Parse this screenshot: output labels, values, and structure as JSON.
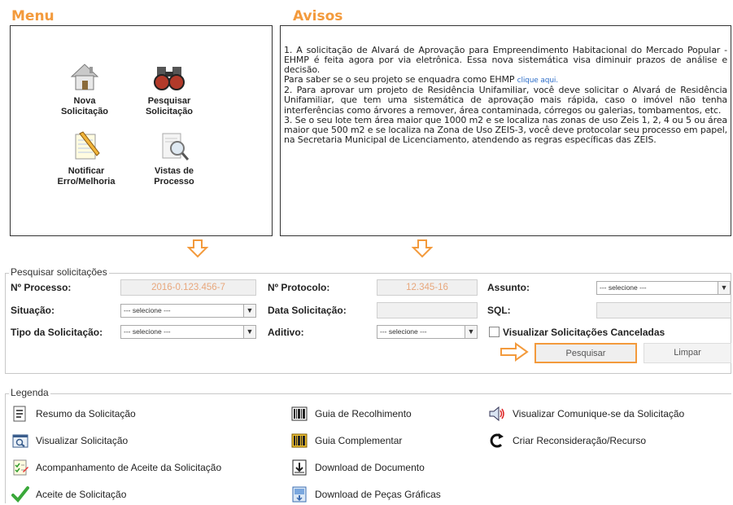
{
  "menu": {
    "title": "Menu",
    "items": [
      {
        "label1": "Nova",
        "label2": "Solicitação",
        "icon": "house-icon"
      },
      {
        "label1": "Pesquisar",
        "label2": "Solicitação",
        "icon": "binoculars-icon"
      },
      {
        "label1": "Notificar",
        "label2": "Erro/Melhoria",
        "icon": "notepad-pencil-icon"
      },
      {
        "label1": "Vistas de",
        "label2": "Processo",
        "icon": "magnifier-document-icon"
      }
    ]
  },
  "avisos": {
    "title": "Avisos",
    "p1": "1. A solicitação de Alvará de Aprovação para Empreendimento Habitacional do Mercado Popular - EHMP é feita agora por via eletrônica. Essa nova sistemática visa diminuir prazos de análise e decisão.",
    "p2a": "Para saber se o seu projeto se enquadra como EHMP",
    "p2link": "clique aqui.",
    "p3": "2. Para aprovar um projeto de Residência Unifamiliar, você deve solicitar o Alvará de Residência Unifamiliar, que tem uma sistemática de aprovação mais rápida, caso o imóvel não tenha interferências como árvores a remover, área contaminada, córregos ou galerias, tombamentos, etc.",
    "p4": "3. Se o seu lote tem área maior que 1000 m2 e se localiza nas zonas de uso Zeis 1, 2, 4 ou 5 ou área maior que 500 m2 e se localiza na Zona de Uso ZEIS-3, você deve protocolar seu processo em papel, na Secretaria Municipal de Licenciamento, atendendo as regras específicas das ZEIS."
  },
  "search": {
    "legend": "Pesquisar solicitações",
    "processo_label": "Nº Processo:",
    "processo_value": "2016-0.123.456-7",
    "protocolo_label": "Nº Protocolo:",
    "protocolo_value": "12.345-16",
    "assunto_label": "Assunto:",
    "assunto_value": "--- selecione ---",
    "situacao_label": "Situação:",
    "situacao_value": "--- selecione ---",
    "data_label": "Data Solicitação:",
    "data_value": "",
    "sql_label": "SQL:",
    "sql_value": "",
    "tipo_label": "Tipo da Solicitação:",
    "tipo_value": "--- selecione ---",
    "aditivo_label": "Aditivo:",
    "aditivo_value": "--- selecione ---",
    "canceladas_label": "Visualizar Solicitações Canceladas",
    "pesquisar_label": "Pesquisar",
    "limpar_label": "Limpar"
  },
  "legend": {
    "title": "Legenda",
    "items": [
      {
        "label": "Resumo da Solicitação",
        "icon": "document-summary-icon"
      },
      {
        "label": "Guia de Recolhimento",
        "icon": "barcode-icon"
      },
      {
        "label": "Visualizar Comunique-se da Solicitação",
        "icon": "speaker-icon"
      },
      {
        "label": "Visualizar Solicitação",
        "icon": "view-window-icon"
      },
      {
        "label": "Guia Complementar",
        "icon": "barcode-yellow-icon"
      },
      {
        "label": "Criar Reconsideração/Recurso",
        "icon": "refresh-c-icon"
      },
      {
        "label": "Acompanhamento de Aceite da Solicitação",
        "icon": "checklist-icon"
      },
      {
        "label": "Download de Documento",
        "icon": "document-download-icon"
      },
      {
        "label": "Aceite de Solicitação",
        "icon": "checkmark-icon"
      },
      {
        "label": "Download de Peças Gráficas",
        "icon": "graphics-download-icon"
      }
    ]
  },
  "colors": {
    "accent": "#f39a3c",
    "link": "#2f6fc9",
    "field_value": "#e8a77c"
  }
}
